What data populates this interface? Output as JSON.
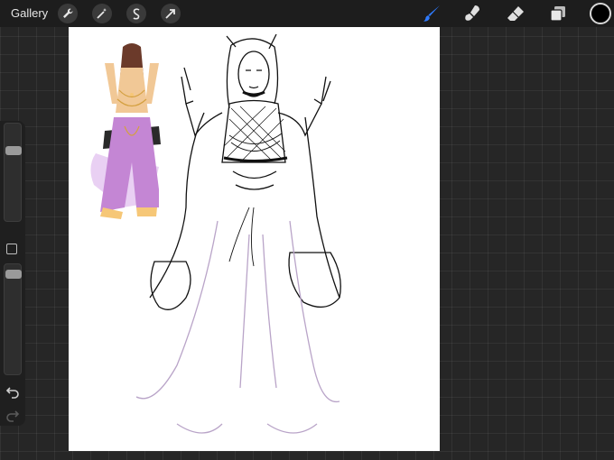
{
  "topbar": {
    "gallery_label": "Gallery",
    "left_tools": [
      {
        "icon": "wrench-icon"
      },
      {
        "icon": "magic-wand-icon"
      },
      {
        "icon": "selection-icon"
      },
      {
        "icon": "transform-arrow-icon"
      }
    ],
    "right_tools": [
      {
        "icon": "brush-icon",
        "active": true,
        "color": "#2f7bff"
      },
      {
        "icon": "smudge-icon"
      },
      {
        "icon": "eraser-icon"
      },
      {
        "icon": "layers-icon"
      }
    ],
    "current_color": "#000000"
  },
  "sidebar": {
    "brush_size_level": 0.75,
    "opacity_level": 0.95,
    "icons": [
      "modify-square-icon",
      "undo-icon",
      "redo-icon"
    ]
  },
  "colors": {
    "skin": "#f1c896",
    "hair": "#6b3a2a",
    "purple": "#c486d4",
    "lilac": "#e4c4f0",
    "gold": "#f6c777",
    "dark": "#2a2a2a"
  }
}
